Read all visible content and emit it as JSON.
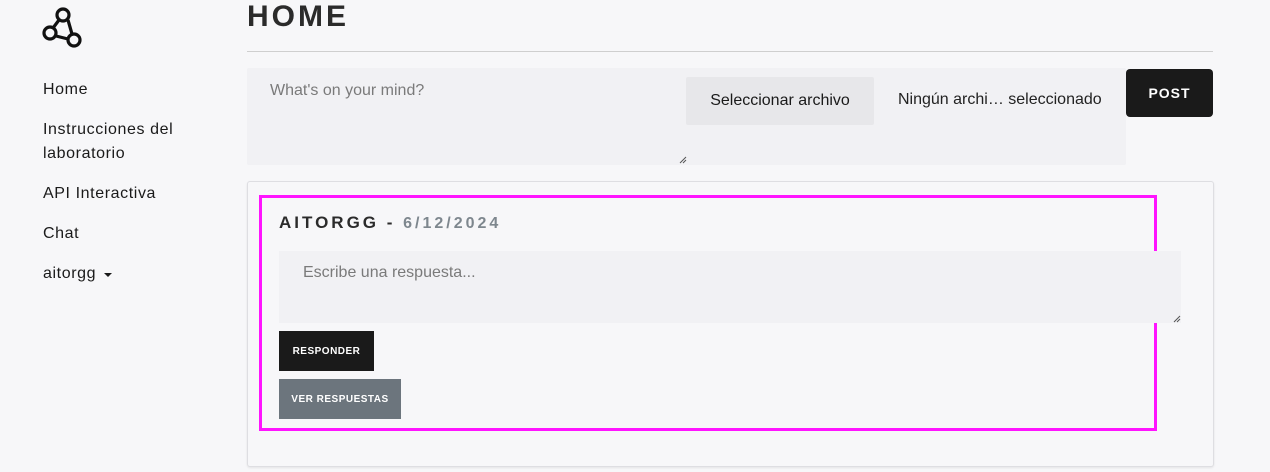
{
  "sidebar": {
    "logo_icon": "network-triangle-icon",
    "items": [
      {
        "label": "Home"
      },
      {
        "label": "Instrucciones del laboratorio"
      },
      {
        "label": "API Interactiva"
      },
      {
        "label": "Chat"
      },
      {
        "label": "aitorgg",
        "icon": "caret-down-icon"
      }
    ]
  },
  "header": {
    "title": "HOME"
  },
  "compose": {
    "placeholder": "What's on your mind?",
    "file_button": "Seleccionar archivo",
    "file_status": "Ningún archi… seleccionado",
    "post_button": "POST"
  },
  "post": {
    "author": "AITORGG",
    "separator": " - ",
    "date": "6/12/2024",
    "reply_placeholder": "Escribe una respuesta...",
    "reply_button": "RESPONDER",
    "view_button": "VER RESPUESTAS"
  },
  "colors": {
    "accent_dark": "#1a1a1a",
    "secondary_button": "#6c757d",
    "highlight": "#ff14ff",
    "date_text": "#7e878e"
  }
}
